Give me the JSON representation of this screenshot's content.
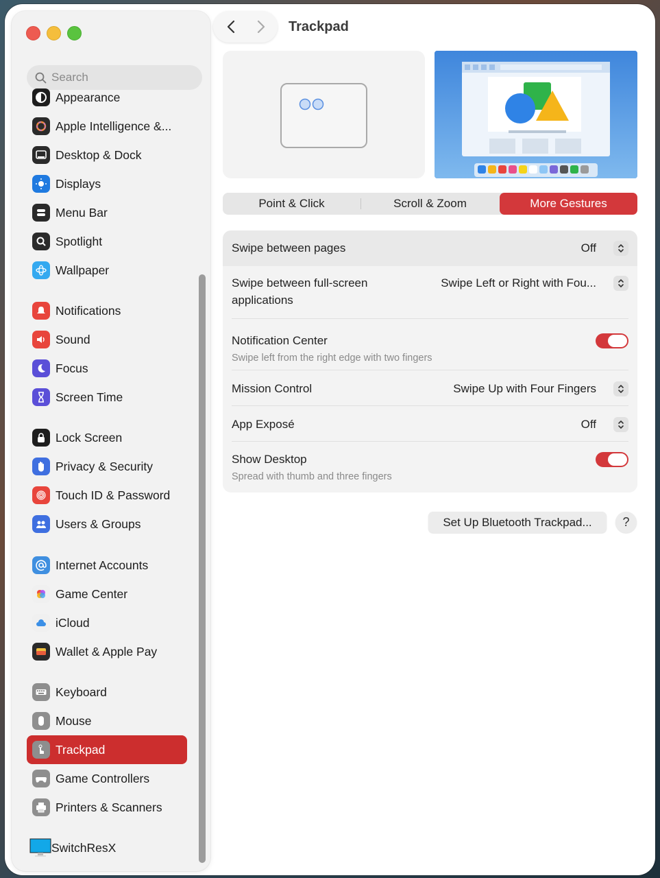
{
  "window": {
    "title": "Trackpad"
  },
  "sidebar": {
    "search_placeholder": "Search",
    "items": [
      {
        "label": "Appearance",
        "icon": "appearance-icon",
        "color": "#1e1e1e"
      },
      {
        "label": "Apple Intelligence &...",
        "icon": "apple-intelligence-icon",
        "color": "#2a2a2a"
      },
      {
        "label": "Desktop & Dock",
        "icon": "desktop-dock-icon",
        "color": "#2a2a2a"
      },
      {
        "label": "Displays",
        "icon": "displays-icon",
        "color": "#1f7ae0"
      },
      {
        "label": "Menu Bar",
        "icon": "menu-bar-icon",
        "color": "#2a2a2a"
      },
      {
        "label": "Spotlight",
        "icon": "spotlight-icon",
        "color": "#2a2a2a"
      },
      {
        "label": "Wallpaper",
        "icon": "wallpaper-icon",
        "color": "#34a9f0"
      },
      {
        "label": "Notifications",
        "icon": "notifications-icon",
        "color": "#e8453c"
      },
      {
        "label": "Sound",
        "icon": "sound-icon",
        "color": "#e8453c"
      },
      {
        "label": "Focus",
        "icon": "focus-icon",
        "color": "#5b4fd8"
      },
      {
        "label": "Screen Time",
        "icon": "screen-time-icon",
        "color": "#5b4fd8"
      },
      {
        "label": "Lock Screen",
        "icon": "lock-screen-icon",
        "color": "#1e1e1e"
      },
      {
        "label": "Privacy & Security",
        "icon": "privacy-hand-icon",
        "color": "#3f6fe0"
      },
      {
        "label": "Touch ID & Password",
        "icon": "fingerprint-icon",
        "color": "#e8453c"
      },
      {
        "label": "Users & Groups",
        "icon": "users-groups-icon",
        "color": "#3f6fe0"
      },
      {
        "label": "Internet Accounts",
        "icon": "at-sign-icon",
        "color": "#3f8fe0"
      },
      {
        "label": "Game Center",
        "icon": "game-center-icon",
        "color": "#f0f0f0"
      },
      {
        "label": "iCloud",
        "icon": "icloud-icon",
        "color": "#f0f0f0"
      },
      {
        "label": "Wallet & Apple Pay",
        "icon": "wallet-icon",
        "color": "#2a2a2a"
      },
      {
        "label": "Keyboard",
        "icon": "keyboard-icon",
        "color": "#8e8e8e"
      },
      {
        "label": "Mouse",
        "icon": "mouse-icon",
        "color": "#8e8e8e"
      },
      {
        "label": "Trackpad",
        "icon": "trackpad-icon",
        "color": "#8e8e8e"
      },
      {
        "label": "Game Controllers",
        "icon": "game-controller-icon",
        "color": "#8e8e8e"
      },
      {
        "label": "Printers & Scanners",
        "icon": "printer-icon",
        "color": "#8e8e8e"
      },
      {
        "label": "SwitchResX",
        "icon": "switchresx-monitor-icon",
        "color": "#12a8e8"
      }
    ],
    "selected": "Trackpad"
  },
  "tabs": [
    "Point & Click",
    "Scroll & Zoom",
    "More Gestures"
  ],
  "active_tab": "More Gestures",
  "settings": [
    {
      "title": "Swipe between pages",
      "value": "Off",
      "control": "stepper"
    },
    {
      "title": "Swipe between full-screen",
      "title2": "applications",
      "value": "Swipe Left or Right with Fou...",
      "control": "stepper"
    },
    {
      "title": "Notification Center",
      "subtitle": "Swipe left from the right edge with two fingers",
      "control": "toggle",
      "on": true
    },
    {
      "title": "Mission Control",
      "value": "Swipe Up with Four Fingers",
      "control": "stepper"
    },
    {
      "title": "App Exposé",
      "value": "Off",
      "control": "stepper"
    },
    {
      "title": "Show Desktop",
      "subtitle": "Spread with thumb and three fingers",
      "control": "toggle",
      "on": true
    }
  ],
  "buttons": {
    "bluetooth": "Set Up Bluetooth Trackpad...",
    "help": "?"
  },
  "colors": {
    "accent": "#d3383b",
    "selected_sidebar": "#cc2e2e"
  }
}
